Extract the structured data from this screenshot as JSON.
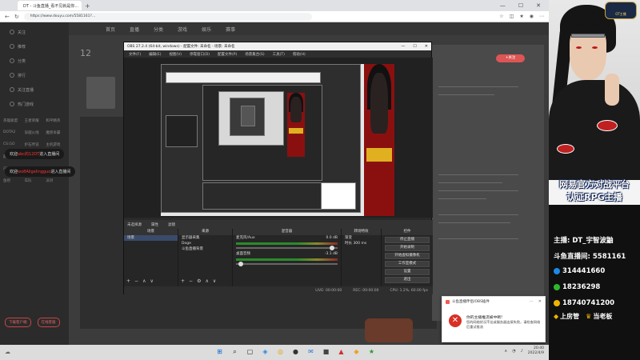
{
  "browser": {
    "tab_title": "DT - 斗鱼直播_看不见就是你...",
    "url": "https://www.douyu.com/5581161?...",
    "window_controls": [
      "—",
      "☐",
      "✕"
    ]
  },
  "page": {
    "nav_items": [
      "首页",
      "直播",
      "分类",
      "游戏",
      "娱乐",
      "赛事"
    ],
    "sidebar_items": [
      "关注",
      "推荐",
      "分类",
      "排行",
      "关注直播",
      "热门游戏"
    ],
    "sidebar_grid": [
      "英雄联盟",
      "王者荣耀",
      "和平精英",
      "DOTA2",
      "穿越火线",
      "魔兽争霸",
      "CS:GO",
      "炉石传说",
      "主机游戏",
      "颜值",
      "舞蹈",
      "音乐",
      "户外",
      "二次元",
      "一起看",
      "鱼吧",
      "车队",
      "派对"
    ],
    "sidebar_bottom": [
      "下载客户端",
      "在线客服"
    ],
    "streamer_level": "12",
    "follow_pill": "+关注",
    "danmaku": [
      {
        "prefix": "欢迎",
        "user": "abc的12DT",
        "suffix": "进入直播间"
      },
      {
        "prefix": "欢迎",
        "user": "wo8Aligelingguo",
        "suffix": "进入直播间"
      }
    ]
  },
  "obs": {
    "title": "OBS 27.2.4 (64-bit, windows) - 配置文件: 未命名 - 场景: 未命名",
    "menu": [
      "文件(F)",
      "编辑(E)",
      "视图(V)",
      "停靠窗口(D)",
      "配置文件(P)",
      "场景集合(S)",
      "工具(T)",
      "帮助(H)"
    ],
    "sources_bar": [
      "未选择源",
      "属性",
      "滤镜"
    ],
    "docks": {
      "scenes": {
        "header": "场景",
        "items": [
          "场景"
        ]
      },
      "sources": {
        "header": "来源",
        "items": [
          "显示器采集",
          "Doge",
          "斗鱼直播背景"
        ]
      },
      "mixer": {
        "header": "混音器",
        "channels": [
          {
            "name": "麦克风/Aux",
            "db": "0.0 dB"
          },
          {
            "name": "桌面音频",
            "db": "-3.1 dB"
          }
        ]
      },
      "transitions": {
        "header": "转场特效",
        "type": "渐变",
        "duration_label": "时长",
        "duration": "300 ms"
      },
      "controls": {
        "header": "控件",
        "buttons": [
          "停止直播",
          "开始录制",
          "开始虚拟摄像机",
          "工作室模式",
          "设置",
          "退出"
        ]
      }
    },
    "status": [
      "LIVE: 00:00:00",
      "REC: 00:00:00",
      "CPU: 1.2%, 60.00 fps"
    ]
  },
  "toast": {
    "app": "斗鱼直播伴侣/OBS插件",
    "title": "你的主播推流被中断!",
    "body": "您的网络状况不佳或服务器连接失败，请检查网络后重试推流"
  },
  "taskbar": {
    "time": "20:40",
    "date": "2022/4/9",
    "apps": [
      "⊞",
      "⌕",
      "▢",
      "◈",
      "◎",
      "●",
      "✉",
      "■",
      "▲",
      "◆",
      "★"
    ]
  },
  "streamer_panel": {
    "logo": "OT主播",
    "slogan_line1": "网易官方对战平台",
    "slogan_line2": "认证RPG主播",
    "lines": [
      {
        "label": "主播:",
        "value": "DT_宇智波鼬"
      },
      {
        "label": "斗鱼直播间:",
        "value": "5581161"
      },
      {
        "label": "",
        "value": "314441660"
      },
      {
        "label": "",
        "value": "18236298"
      },
      {
        "label": "",
        "value": "18740741200"
      }
    ],
    "bottom": [
      "上房管",
      "当老板"
    ],
    "colors": {
      "qq": "#1b8ae6",
      "wechat": "#2eb82e",
      "phone": "#f0b400",
      "slogan_outline": "#1a3a8a"
    }
  }
}
